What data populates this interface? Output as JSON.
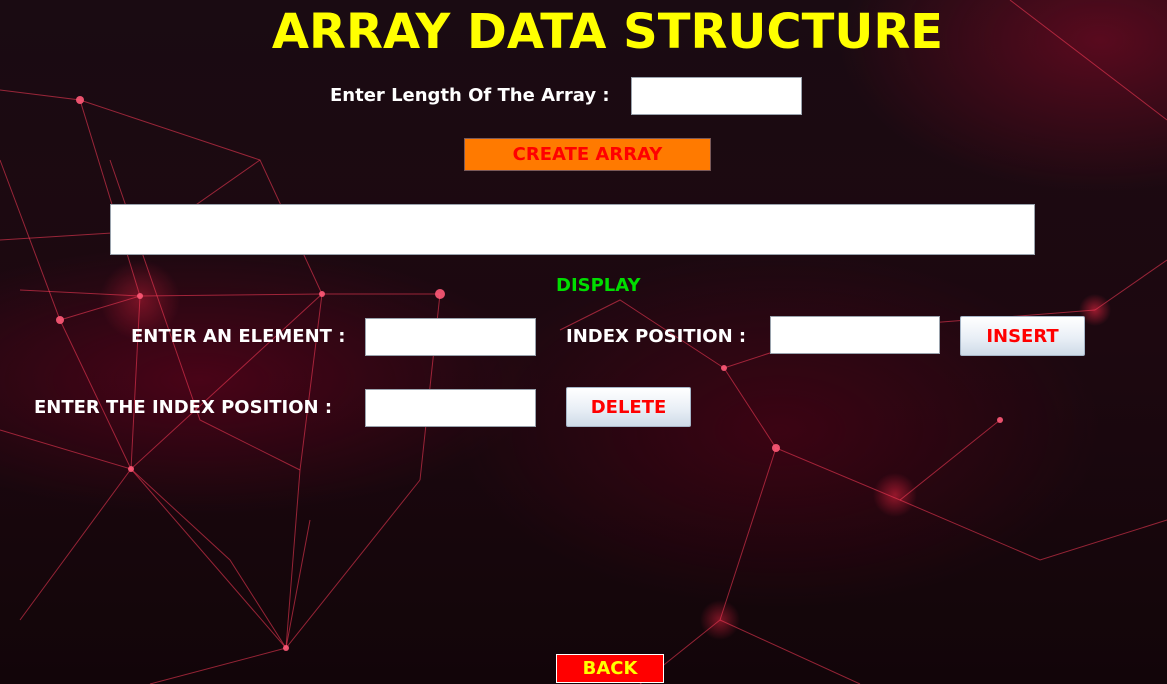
{
  "page": {
    "title": "ARRAY DATA STRUCTURE"
  },
  "colors": {
    "title": "#ffff00",
    "label": "#ffffff",
    "display_label": "#00dd00",
    "button_text_red": "#ff0000",
    "create_button_bg": "#ff7a00",
    "back_button_bg": "#ff0000",
    "back_button_text": "#ffff00"
  },
  "length_section": {
    "label": "Enter Length Of The Array  :",
    "input_value": "",
    "create_button": "CREATE ARRAY"
  },
  "display_section": {
    "output_value": "",
    "label": "DISPLAY"
  },
  "insert_section": {
    "element_label": "ENTER AN ELEMENT :",
    "element_value": "",
    "index_label": "INDEX POSITION :",
    "index_value": "",
    "insert_button": "INSERT"
  },
  "delete_section": {
    "index_label": "ENTER THE INDEX POSITION :",
    "index_value": "",
    "delete_button": "DELETE"
  },
  "footer": {
    "back_button": "BACK"
  }
}
